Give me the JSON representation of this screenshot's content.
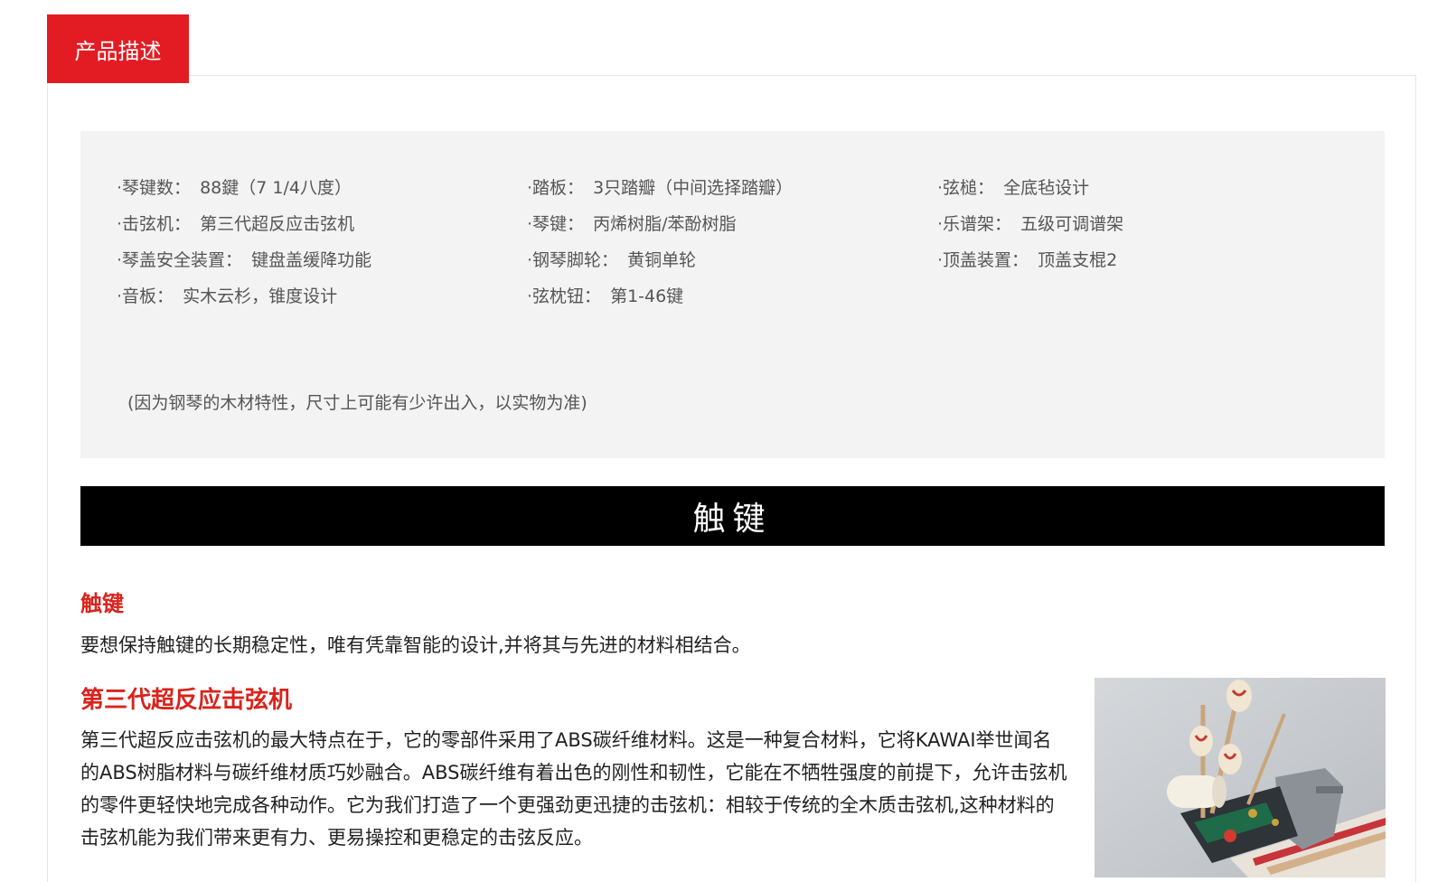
{
  "tab": {
    "label": "产品描述"
  },
  "specs": {
    "columns": [
      [
        {
          "key": "琴键数：",
          "value": "88鍵（7 1/4八度）"
        },
        {
          "key": "击弦机：",
          "value": "第三代超反应击弦机"
        },
        {
          "key": "琴盖安全装置：",
          "value": "键盘盖缓降功能"
        },
        {
          "key": "音板：",
          "value": "实木云杉，锥度设计"
        }
      ],
      [
        {
          "key": "踏板：",
          "value": "3只踏瓣（中间选择踏瓣）"
        },
        {
          "key": "琴键：",
          "value": "丙烯树脂/苯酚树脂"
        },
        {
          "key": "钢琴脚轮：",
          "value": "黄铜单轮"
        },
        {
          "key": "弦枕钮：",
          "value": "第1-46键"
        }
      ],
      [
        {
          "key": "弦槌：",
          "value": "全底毡设计"
        },
        {
          "key": "乐谱架：",
          "value": "五级可调谱架"
        },
        {
          "key": "顶盖装置：",
          "value": "顶盖支棍2"
        }
      ]
    ],
    "bullet": "·",
    "note": "(因为钢琴的木材特性，尺寸上可能有少许出入，以实物为准)"
  },
  "banner": {
    "title": "触键"
  },
  "section1": {
    "heading": "触键",
    "text": "要想保持触键的长期稳定性，唯有凭靠智能的设计,并将其与先进的材料相结合。"
  },
  "section2": {
    "heading": "第三代超反应击弦机",
    "text": "第三代超反应击弦机的最大特点在于，它的零部件采用了ABS碳纤维材料。这是一种复合材料，它将KAWAI举世闻名的ABS树脂材料与碳纤维材质巧妙融合。ABS碳纤维有着出色的刚性和韧性，它能在不牺牲强度的前提下，允许击弦机的零件更轻快地完成各种动作。它为我们打造了一个更强劲更迅捷的击弦机：相较于传统的全木质击弦机,这种材料的击弦机能为我们带来更有力、更易操控和更稳定的击弦反应。"
  },
  "colors": {
    "accent": "#e31b23",
    "heading_red": "#d9231d",
    "spec_bg": "#f3f3f3",
    "banner_bg": "#000000"
  },
  "photo": {
    "icon": "piano-action-hammer-photo"
  }
}
